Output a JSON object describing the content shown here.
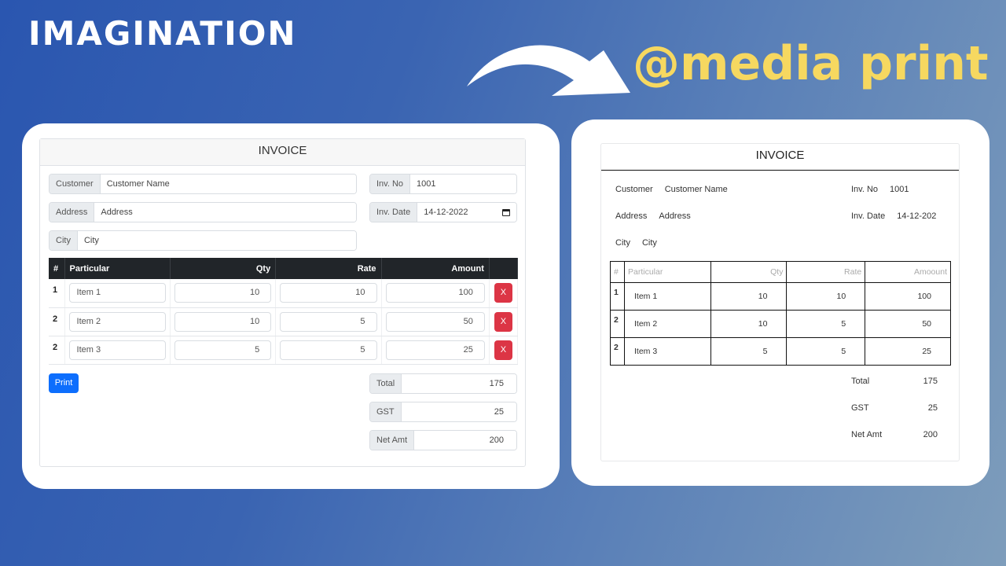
{
  "banner": {
    "headline": "IMAGINATION",
    "subtitle": "@media print",
    "arrow_icon": "curved-arrow-right",
    "colors": {
      "headline": "#ffffff",
      "subtitle": "#f6d860",
      "bg_start": "#2a56b0",
      "bg_end": "#7e9dbb"
    }
  },
  "screen_form": {
    "title": "INVOICE",
    "fields": {
      "customer": {
        "label": "Customer",
        "value": "Customer Name"
      },
      "address": {
        "label": "Address",
        "value": "Address"
      },
      "city": {
        "label": "City",
        "value": "City"
      },
      "inv_no": {
        "label": "Inv. No",
        "value": "1001"
      },
      "inv_date": {
        "label": "Inv. Date",
        "value": "14-12-2022",
        "icon": "calendar-icon"
      }
    },
    "table": {
      "headers": [
        "#",
        "Particular",
        "Qty",
        "Rate",
        "Amount",
        ""
      ],
      "rows": [
        {
          "num": "1",
          "particular": "Item 1",
          "qty": "10",
          "rate": "10",
          "amount": "100",
          "delete": "X"
        },
        {
          "num": "2",
          "particular": "Item 2",
          "qty": "10",
          "rate": "5",
          "amount": "50",
          "delete": "X"
        },
        {
          "num": "2",
          "particular": "Item 3",
          "qty": "5",
          "rate": "5",
          "amount": "25",
          "delete": "X"
        }
      ]
    },
    "print_button": "Print",
    "totals": {
      "total": {
        "label": "Total",
        "value": "175"
      },
      "gst": {
        "label": "GST",
        "value": "25"
      },
      "net": {
        "label": "Net Amt",
        "value": "200"
      }
    },
    "colors": {
      "primary": "#0d6efd",
      "danger": "#dc3545",
      "table_head": "#212529"
    }
  },
  "print_preview": {
    "title": "INVOICE",
    "fields": {
      "customer": {
        "label": "Customer",
        "value": "Customer Name"
      },
      "address": {
        "label": "Address",
        "value": "Address"
      },
      "city": {
        "label": "City",
        "value": "City"
      },
      "inv_no": {
        "label": "Inv. No",
        "value": "1001"
      },
      "inv_date": {
        "label": "Inv. Date",
        "value": "14-12-202"
      }
    },
    "table": {
      "headers": [
        "#",
        "Particular",
        "Qty",
        "Rate",
        "Amoount"
      ],
      "rows": [
        {
          "num": "1",
          "particular": "Item 1",
          "qty": "10",
          "rate": "10",
          "amount": "100"
        },
        {
          "num": "2",
          "particular": "Item 2",
          "qty": "10",
          "rate": "5",
          "amount": "50"
        },
        {
          "num": "2",
          "particular": "Item 3",
          "qty": "5",
          "rate": "5",
          "amount": "25"
        }
      ]
    },
    "totals": {
      "total": {
        "label": "Total",
        "value": "175"
      },
      "gst": {
        "label": "GST",
        "value": "25"
      },
      "net": {
        "label": "Net Amt",
        "value": "200"
      }
    }
  }
}
